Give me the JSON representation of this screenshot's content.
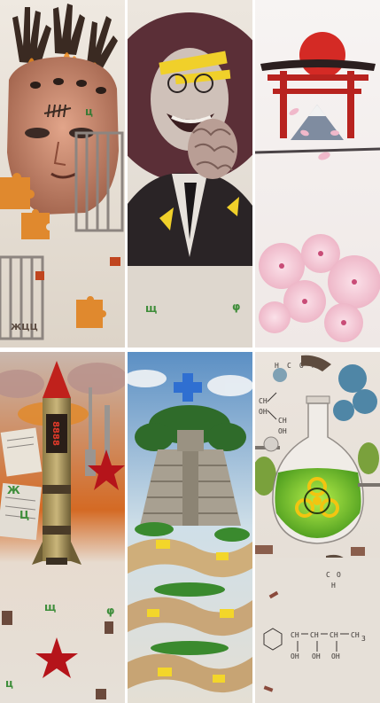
{
  "panels": [
    {
      "id": "p1",
      "subject": "fractured-head-collage"
    },
    {
      "id": "p2",
      "subject": "laughing-man-brain-collage"
    },
    {
      "id": "p3",
      "subject": "japanese-torii-sakura"
    },
    {
      "id": "p4",
      "subject": "soviet-rocket-collage"
    },
    {
      "id": "p5",
      "subject": "mayan-pyramid-collage"
    },
    {
      "id": "p6",
      "subject": "biohazard-flask-chemistry"
    }
  ],
  "p1": {
    "tally": "ЖЦЦ",
    "scattered": [
      "ц",
      "ц"
    ]
  },
  "p2": {
    "letters": [
      "щ",
      "φ"
    ]
  },
  "p4": {
    "rocket_display": "8888",
    "letters": [
      "Ж",
      "Ц",
      "щ",
      "φ",
      "ц"
    ]
  },
  "p6": {
    "formula_top": [
      "H",
      "C",
      "O",
      "H",
      "CH",
      "OH",
      "CH",
      "OH"
    ],
    "formula_bottom": [
      "C",
      "O",
      "H",
      "CH",
      "OH",
      "CH",
      "OH",
      "CH",
      "OH",
      "CH",
      "3"
    ]
  },
  "colors": {
    "paper": "#e9e3db",
    "torii_red": "#b8231f",
    "rising_sun": "#d42a25",
    "sakura_pink": "#f2c3d3",
    "rocket_red": "#c0211c",
    "star_red": "#b5141a",
    "acid_green": "#7ed321",
    "cross_blue": "#2f6fd1",
    "biohazard_yellow": "#f2c511"
  }
}
